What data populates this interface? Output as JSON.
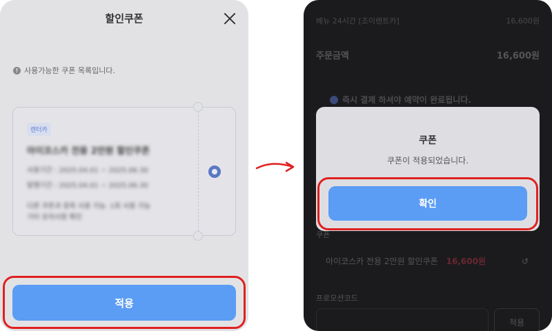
{
  "left": {
    "title": "할인쿠폰",
    "notice": "사용가능한 쿠폰 목록입니다.",
    "coupon": {
      "tag": "렌터카",
      "name": "아이코스카 전용 2만원 할인쿠폰",
      "line1": "사용기간 : 2025.04.01 ~ 2025.06.30",
      "line2": "발행기간 : 2025.04.01 ~ 2025.06.30",
      "line3": "다른 쿠폰과 중복 사용 가능. 1회 사용 가능",
      "line4": "기타 유의사항 확인",
      "selected": true
    },
    "apply_label": "적용"
  },
  "right": {
    "item_label": "베뉴 24시간 [조이렌트카]",
    "item_price": "16,600원",
    "total_label": "주문금액",
    "total_price": "16,600원",
    "notice": "즉시 결제 하셔야 예약이 완료됩니다.",
    "dialog": {
      "title": "쿠폰",
      "message": "쿠폰이 적용되었습니다.",
      "confirm_label": "확인"
    },
    "section_label_cut": "쿠폰",
    "applied_coupon": "아이코스카 전용 2만원 할인쿠폰",
    "applied_price": "16,600원",
    "reset_icon": "↺",
    "promo_label": "프로모션코드",
    "promo_apply_label": "적용"
  },
  "colors": {
    "accent": "#5b9cf5",
    "highlight": "#e01f1f"
  }
}
